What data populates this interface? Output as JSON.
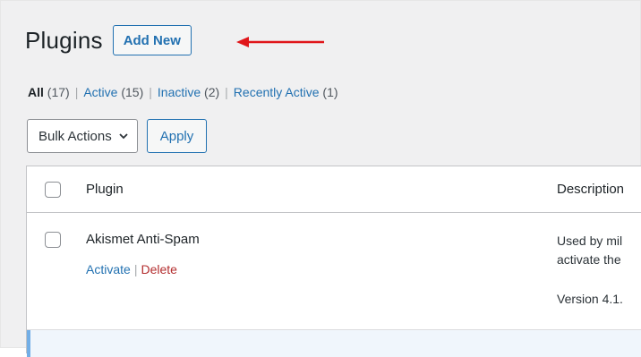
{
  "header": {
    "title": "Plugins",
    "add_new_label": "Add New",
    "annotation_color": "#e0161a"
  },
  "filters": {
    "all_label": "All",
    "all_count": "(17)",
    "active_label": "Active",
    "active_count": "(15)",
    "inactive_label": "Inactive",
    "inactive_count": "(2)",
    "recent_label": "Recently Active",
    "recent_count": "(1)",
    "separator": "|"
  },
  "bulk": {
    "selected": "Bulk Actions",
    "apply_label": "Apply"
  },
  "table": {
    "columns": [
      "Plugin",
      "Description"
    ],
    "rows": [
      {
        "name": "Akismet Anti-Spam",
        "actions": [
          "Activate",
          "Delete"
        ],
        "action_separator": "|",
        "description_line1": "Used by mil",
        "description_line2": "activate the",
        "version": "Version 4.1."
      }
    ]
  },
  "colors": {
    "link": "#2271b1",
    "delete": "#b32d2e",
    "active_row_indicator": "#72aee6"
  },
  "icons": {
    "dropdown": "chevron-down-icon",
    "annotation": "red-arrow-icon"
  }
}
